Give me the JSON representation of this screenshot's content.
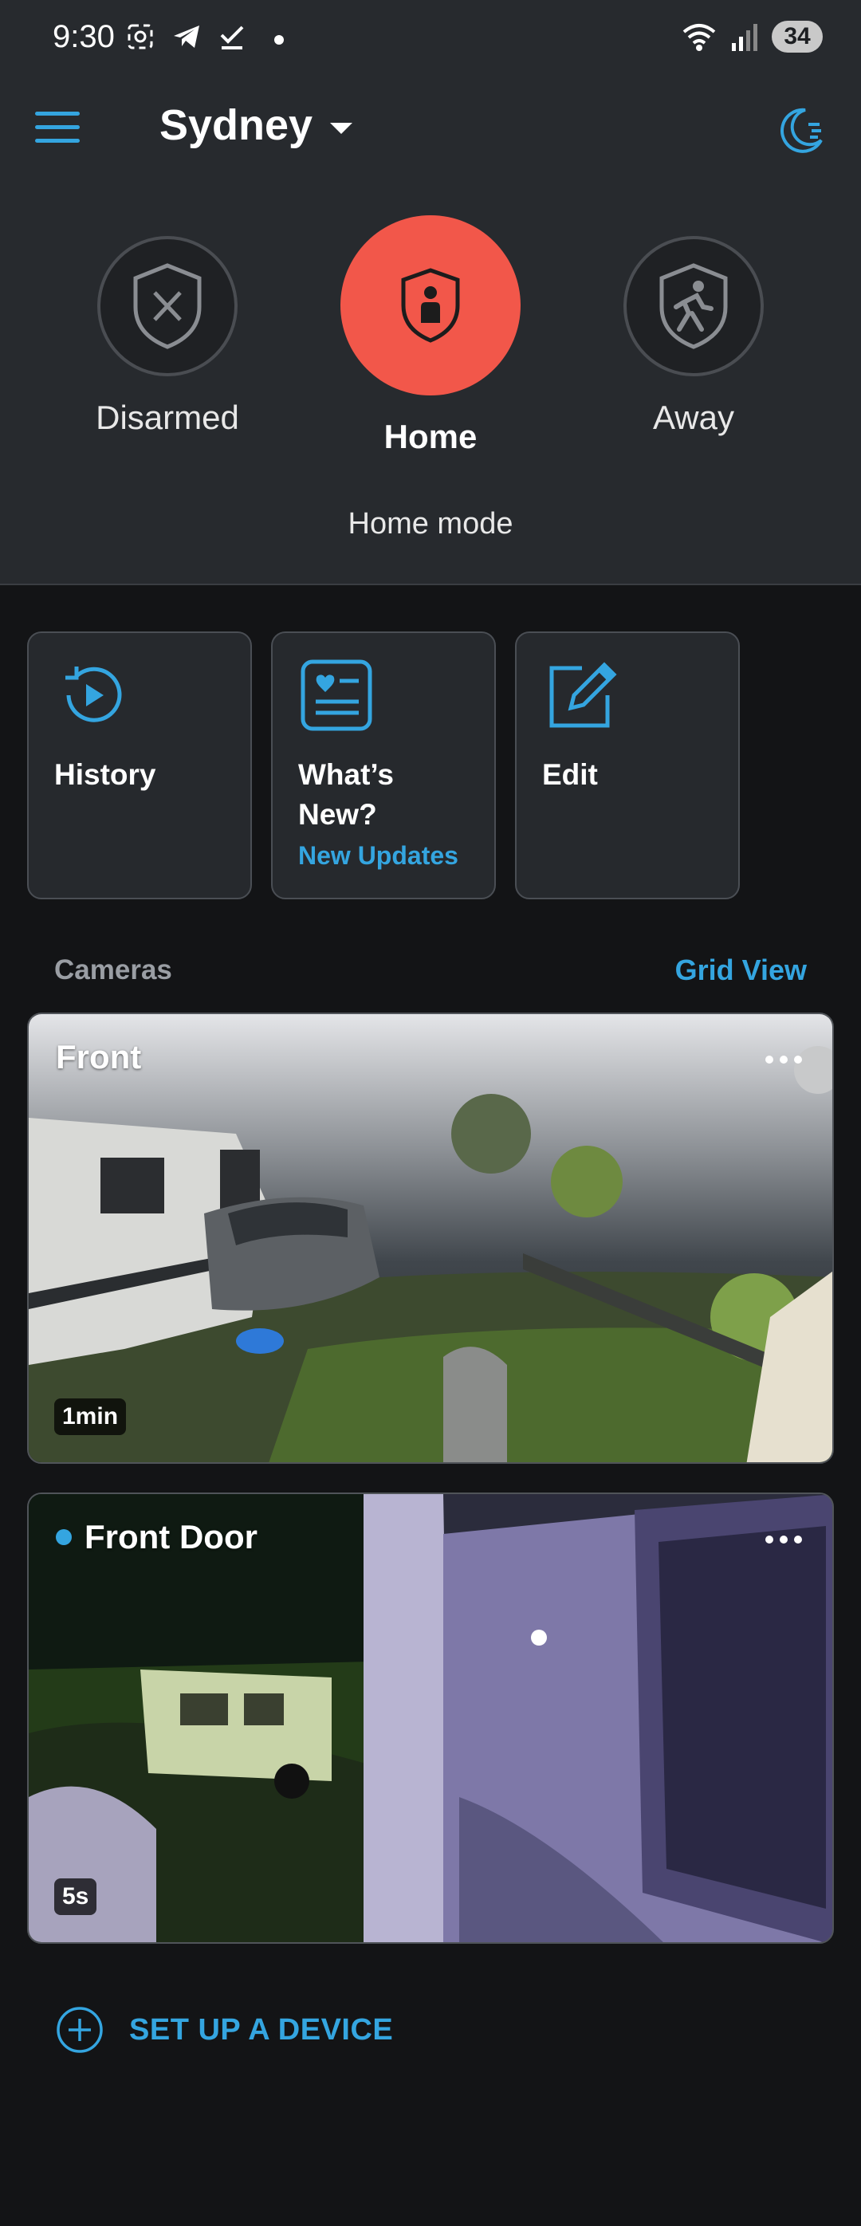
{
  "status_bar": {
    "time": "9:30",
    "battery": "34",
    "icons": [
      "screenshot-icon",
      "telegram-icon",
      "check-icon",
      "dot-icon",
      "wifi-icon",
      "signal-icon"
    ]
  },
  "header": {
    "location": "Sydney",
    "menu_icon": "hamburger-menu-icon",
    "night_icon": "moon-icon"
  },
  "modes": {
    "items": [
      {
        "id": "disarmed",
        "label": "Disarmed",
        "active": false
      },
      {
        "id": "home",
        "label": "Home",
        "active": true
      },
      {
        "id": "away",
        "label": "Away",
        "active": false
      }
    ],
    "description": "Home mode"
  },
  "tiles": [
    {
      "id": "history",
      "title": "History",
      "subtitle": "",
      "icon": "history-icon"
    },
    {
      "id": "whats-new",
      "title": "What’s New?",
      "subtitle": "New Updates",
      "icon": "news-card-icon"
    },
    {
      "id": "edit",
      "title": "Edit",
      "subtitle": "",
      "icon": "edit-icon"
    }
  ],
  "cameras": {
    "label": "Cameras",
    "grid_view": "Grid View",
    "items": [
      {
        "name": "Front",
        "age": "1min",
        "live": false
      },
      {
        "name": "Front Door",
        "age": "5s",
        "live": true
      }
    ]
  },
  "setup": {
    "label": "SET UP A DEVICE"
  },
  "colors": {
    "accent": "#34a5e0",
    "home_active": "#f2574a",
    "background": "#131416",
    "top_background": "#272a2e"
  }
}
